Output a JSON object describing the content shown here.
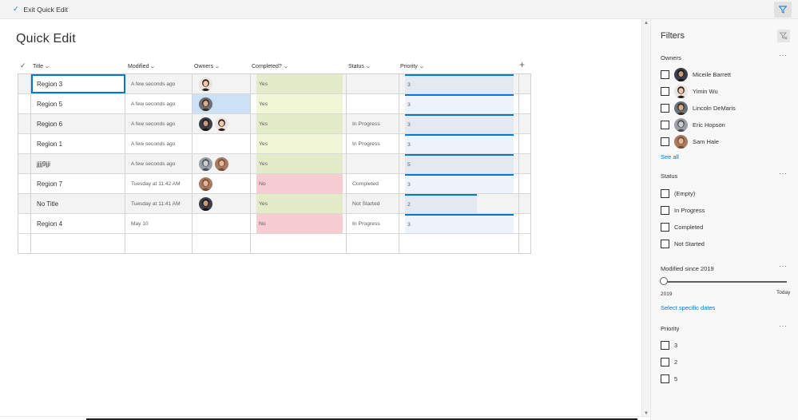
{
  "command_bar": {
    "exit_label": "Exit Quick Edit"
  },
  "page_title": "Quick Edit",
  "columns": [
    "Title",
    "Modified",
    "Owners",
    "Completed?",
    "Status",
    "Priority"
  ],
  "rows": [
    {
      "title": "Region 3",
      "modified": "A few seconds ago",
      "owners": [
        "p1"
      ],
      "completed": "Yes",
      "status": "",
      "priority": "3",
      "priority_fill": 1.0
    },
    {
      "title": "Region 5",
      "modified": "A few seconds ago",
      "owners": [
        "p3"
      ],
      "completed": "Yes",
      "status": "",
      "priority": "3",
      "priority_fill": 1.0
    },
    {
      "title": "Region 6",
      "modified": "A few seconds ago",
      "owners": [
        "p2",
        "p1"
      ],
      "completed": "Yes",
      "status": "In Progress",
      "priority": "3",
      "priority_fill": 1.0
    },
    {
      "title": "Region 1",
      "modified": "A few seconds ago",
      "owners": [],
      "completed": "Yes",
      "status": "In Progress",
      "priority": "3",
      "priority_fill": 1.0
    },
    {
      "title": "jjjj9jji",
      "modified": "A few seconds ago",
      "owners": [
        "p4",
        "p5"
      ],
      "completed": "Yes",
      "status": "",
      "priority": "5",
      "priority_fill": 1.0
    },
    {
      "title": "Region 7",
      "modified": "Tuesday at 11:42 AM",
      "owners": [
        "p5"
      ],
      "completed": "No",
      "status": "Completed",
      "priority": "3",
      "priority_fill": 1.0
    },
    {
      "title": "No Title",
      "modified": "Tuesday at 11:41 AM",
      "owners": [
        "p2"
      ],
      "completed": "Yes",
      "status": "Not Started",
      "priority": "2",
      "priority_fill": 0.66
    },
    {
      "title": "Region 4",
      "modified": "May 10",
      "owners": [],
      "completed": "No",
      "status": "In Progress",
      "priority": "3",
      "priority_fill": 1.0
    }
  ],
  "filters": {
    "title": "Filters",
    "owners": {
      "title": "Owners",
      "items": [
        {
          "label": "Miceile Barrett",
          "avatar": "p2"
        },
        {
          "label": "Yimin Wu",
          "avatar": "p1"
        },
        {
          "label": "Lincoln DeMaris",
          "avatar": "p3"
        },
        {
          "label": "Eric Hopson",
          "avatar": "p4"
        },
        {
          "label": "Sam Hale",
          "avatar": "p5"
        }
      ],
      "see_all": "See all"
    },
    "status": {
      "title": "Status",
      "items": [
        "(Empty)",
        "In Progress",
        "Completed",
        "Not Started"
      ]
    },
    "modified": {
      "title": "Modified since 2019",
      "min_label": "2019",
      "max_label": "Today",
      "link": "Select specific dates"
    },
    "priority": {
      "title": "Priority",
      "items": [
        "3",
        "2",
        "5"
      ]
    }
  },
  "colors": {
    "accent": "#0078d4",
    "yes_fill": "#e4ebc8",
    "no_fill": "#f7cdd2",
    "priority_fill": "#e3e8f1"
  },
  "icons": {
    "exit": "checkmark-icon",
    "filter": "filter-icon",
    "clear_filter": "clear-filter-icon",
    "add_column": "plus-icon",
    "sort": "chevron-down-icon",
    "more": "ellipsis-icon"
  }
}
